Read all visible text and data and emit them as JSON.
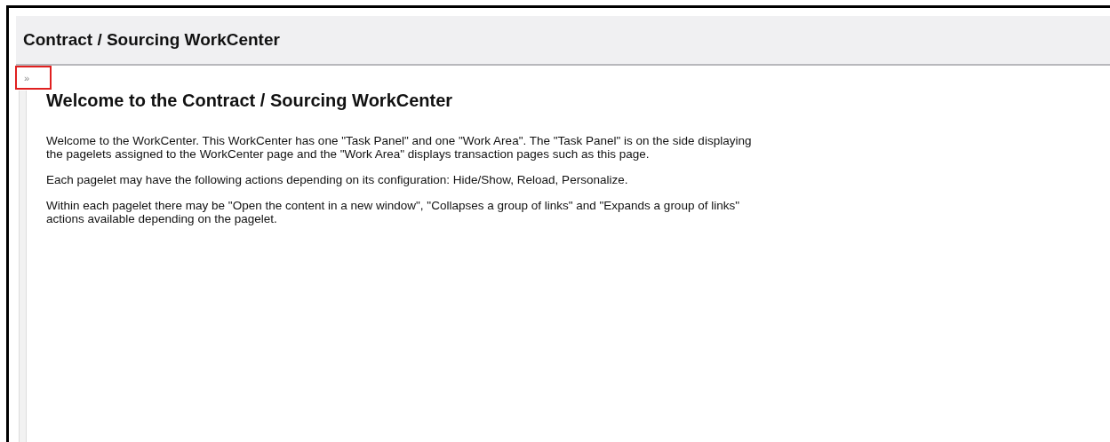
{
  "header": {
    "title": "Contract / Sourcing WorkCenter"
  },
  "expand_button": {
    "label": "»",
    "highlighted": true
  },
  "content": {
    "heading": "Welcome to the Contract / Sourcing WorkCenter",
    "paragraphs": [
      "Welcome to the WorkCenter. This WorkCenter has one \"Task Panel\" and one \"Work Area\". The \"Task Panel\" is on the side displaying the pagelets assigned to the WorkCenter page and the \"Work Area\" displays transaction pages such as this page.",
      "Each pagelet may have the following actions depending on its configuration: Hide/Show, Reload, Personalize.",
      "Within each pagelet there may be \"Open the content in a new window\", \"Collapses a group of links\" and \"Expands a group of links\" actions available depending on the pagelet."
    ]
  }
}
